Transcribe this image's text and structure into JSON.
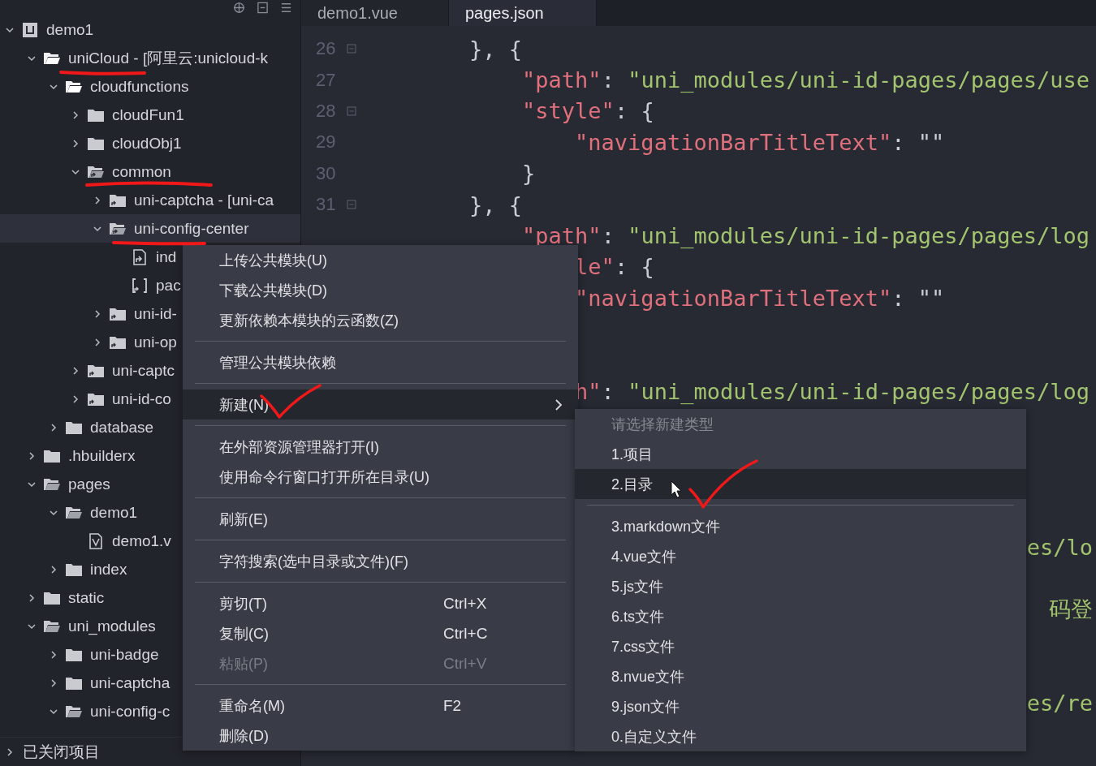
{
  "sidebar": {
    "tree": [
      {
        "label": "demo1",
        "kind": "project",
        "expanded": true,
        "selected": false,
        "children": [
          {
            "label": "uniCloud",
            "suffix": " - [阿里云:unicloud-k",
            "kind": "cloud-folder",
            "expanded": true,
            "selected": false,
            "children": [
              {
                "label": "cloudfunctions",
                "kind": "cloud-folder",
                "expanded": true,
                "selected": false,
                "children": [
                  {
                    "label": "cloudFun1",
                    "kind": "folder",
                    "expanded": false,
                    "selected": false
                  },
                  {
                    "label": "cloudObj1",
                    "kind": "folder",
                    "expanded": false,
                    "selected": false
                  },
                  {
                    "label": "common",
                    "kind": "link-folder",
                    "expanded": true,
                    "selected": false,
                    "children": [
                      {
                        "label": "uni-captcha",
                        "suffix": " - [uni-ca",
                        "kind": "link-folder",
                        "expanded": false,
                        "selected": false
                      },
                      {
                        "label": "uni-config-center",
                        "kind": "link-folder",
                        "expanded": true,
                        "selected": true,
                        "children": [
                          {
                            "label": "ind",
                            "kind": "link-file",
                            "selected": false
                          },
                          {
                            "label": "pac",
                            "kind": "json-file",
                            "selected": false
                          }
                        ]
                      },
                      {
                        "label": "uni-id-",
                        "kind": "link-folder",
                        "expanded": false,
                        "selected": false
                      },
                      {
                        "label": "uni-op",
                        "kind": "link-folder",
                        "expanded": false,
                        "selected": false
                      }
                    ]
                  },
                  {
                    "label": "uni-captc",
                    "kind": "link-folder",
                    "expanded": false,
                    "selected": false
                  },
                  {
                    "label": "uni-id-co",
                    "kind": "link-folder",
                    "expanded": false,
                    "selected": false
                  }
                ]
              },
              {
                "label": "database",
                "kind": "folder",
                "expanded": false,
                "selected": false
              }
            ]
          },
          {
            "label": ".hbuilderx",
            "kind": "folder",
            "expanded": false,
            "selected": false
          },
          {
            "label": "pages",
            "kind": "folder",
            "expanded": true,
            "selected": false,
            "children": [
              {
                "label": "demo1",
                "kind": "folder",
                "expanded": true,
                "selected": false,
                "children": [
                  {
                    "label": "demo1.v",
                    "kind": "vue-file",
                    "selected": false
                  }
                ]
              },
              {
                "label": "index",
                "kind": "folder",
                "expanded": false,
                "selected": false
              }
            ]
          },
          {
            "label": "static",
            "kind": "folder",
            "expanded": false,
            "selected": false
          },
          {
            "label": "uni_modules",
            "kind": "folder",
            "expanded": true,
            "selected": false,
            "children": [
              {
                "label": "uni-badge",
                "kind": "folder",
                "expanded": false,
                "selected": false
              },
              {
                "label": "uni-captcha",
                "kind": "folder",
                "expanded": false,
                "selected": false
              },
              {
                "label": "uni-config-c",
                "kind": "folder",
                "expanded": true,
                "selected": false
              }
            ]
          }
        ]
      }
    ],
    "closed_projects": {
      "label": "已关闭项目",
      "expanded": false
    }
  },
  "tabs": [
    {
      "label": "demo1.vue",
      "selected": false
    },
    {
      "label": "pages.json",
      "selected": true
    }
  ],
  "editor": {
    "lines": [
      {
        "number": "26",
        "fold": true,
        "kind": "code",
        "tokens": [
          {
            "kind": "punct",
            "text": "        }, {"
          }
        ]
      },
      {
        "number": "27",
        "fold": false,
        "kind": "code",
        "tokens": [
          {
            "kind": "key",
            "text": "            \"path\""
          },
          {
            "kind": "punct",
            "text": ": "
          },
          {
            "kind": "string",
            "text": "\"uni_modules/uni-id-pages/pages/use"
          }
        ]
      },
      {
        "number": "28",
        "fold": true,
        "kind": "code",
        "tokens": [
          {
            "kind": "key",
            "text": "            \"style\""
          },
          {
            "kind": "punct",
            "text": ": {"
          }
        ]
      },
      {
        "number": "29",
        "fold": false,
        "kind": "code",
        "tokens": [
          {
            "kind": "key",
            "text": "                \"navigationBarTitleText\""
          },
          {
            "kind": "punct",
            "text": ": \"\""
          }
        ]
      },
      {
        "number": "30",
        "fold": false,
        "kind": "code",
        "tokens": [
          {
            "kind": "punct",
            "text": "            }"
          }
        ]
      },
      {
        "number": "31",
        "fold": true,
        "kind": "code",
        "tokens": [
          {
            "kind": "punct",
            "text": "        }, {"
          }
        ]
      },
      {
        "kind": "code",
        "tokens": [
          {
            "kind": "key",
            "text": "            \"path\""
          },
          {
            "kind": "punct",
            "text": ": "
          },
          {
            "kind": "string",
            "text": "\"uni_modules/uni-id-pages/pages/log"
          }
        ]
      },
      {
        "kind": "code",
        "tokens": [
          {
            "kind": "key",
            "text": "                le\""
          },
          {
            "kind": "punct",
            "text": ": {"
          }
        ]
      },
      {
        "kind": "code",
        "tokens": [
          {
            "kind": "key",
            "text": "                \"navigationBarTitleText\""
          },
          {
            "kind": "punct",
            "text": ": \"\""
          }
        ]
      },
      {
        "kind": "covered"
      },
      {
        "kind": "covered"
      },
      {
        "kind": "code",
        "tokens": [
          {
            "kind": "key",
            "text": "                h\""
          },
          {
            "kind": "punct",
            "text": ": "
          },
          {
            "kind": "string",
            "text": "\"uni_modules/uni-id-pages/pages/log"
          }
        ]
      },
      {
        "kind": "covered"
      },
      {
        "kind": "covered"
      },
      {
        "kind": "covered"
      },
      {
        "kind": "covered"
      },
      {
        "kind": "edge",
        "tokens": [
          {
            "kind": "string",
            "text": "es/lo"
          }
        ]
      },
      {
        "kind": "covered"
      },
      {
        "kind": "edge",
        "tokens": [
          {
            "kind": "string",
            "text": "码登"
          }
        ]
      },
      {
        "kind": "covered"
      },
      {
        "kind": "covered"
      },
      {
        "kind": "edge",
        "tokens": [
          {
            "kind": "string",
            "text": "es/re"
          }
        ]
      }
    ]
  },
  "context_menu": {
    "groups": [
      [
        {
          "label": "上传公共模块(U)",
          "disabled": false,
          "highlighted": false,
          "submenu": false
        },
        {
          "label": "下载公共模块(D)",
          "disabled": false,
          "highlighted": false,
          "submenu": false
        },
        {
          "label": "更新依赖本模块的云函数(Z)",
          "disabled": false,
          "highlighted": false,
          "submenu": false
        }
      ],
      [
        {
          "label": "管理公共模块依赖",
          "disabled": false,
          "highlighted": false,
          "submenu": false
        }
      ],
      [
        {
          "label": "新建(N)",
          "disabled": false,
          "highlighted": true,
          "submenu": true
        }
      ],
      [
        {
          "label": "在外部资源管理器打开(I)",
          "disabled": false,
          "highlighted": false,
          "submenu": false
        },
        {
          "label": "使用命令行窗口打开所在目录(U)",
          "disabled": false,
          "highlighted": false,
          "submenu": false
        }
      ],
      [
        {
          "label": "刷新(E)",
          "disabled": false,
          "highlighted": false,
          "submenu": false
        }
      ],
      [
        {
          "label": "字符搜索(选中目录或文件)(F)",
          "disabled": false,
          "highlighted": false,
          "submenu": false
        }
      ],
      [
        {
          "label": "剪切(T)",
          "shortcut": "Ctrl+X",
          "disabled": false,
          "highlighted": false,
          "submenu": false
        },
        {
          "label": "复制(C)",
          "shortcut": "Ctrl+C",
          "disabled": false,
          "highlighted": false,
          "submenu": false
        },
        {
          "label": "粘贴(P)",
          "shortcut": "Ctrl+V",
          "disabled": true,
          "highlighted": false,
          "submenu": false
        }
      ],
      [
        {
          "label": "重命名(M)",
          "shortcut": "F2",
          "disabled": false,
          "highlighted": false,
          "submenu": false
        },
        {
          "label": "删除(D)",
          "disabled": false,
          "highlighted": false,
          "submenu": false
        }
      ]
    ]
  },
  "submenu": {
    "header": "请选择新建类型",
    "groups": [
      [
        {
          "label": "1.项目",
          "highlighted": false
        },
        {
          "label": "2.目录",
          "highlighted": true
        }
      ],
      [
        {
          "label": "3.markdown文件",
          "highlighted": false
        },
        {
          "label": "4.vue文件",
          "highlighted": false
        },
        {
          "label": "5.js文件",
          "highlighted": false
        },
        {
          "label": "6.ts文件",
          "highlighted": false
        },
        {
          "label": "7.css文件",
          "highlighted": false
        },
        {
          "label": "8.nvue文件",
          "highlighted": false
        },
        {
          "label": "9.json文件",
          "highlighted": false
        },
        {
          "label": "0.自定义文件",
          "highlighted": false
        }
      ]
    ]
  }
}
